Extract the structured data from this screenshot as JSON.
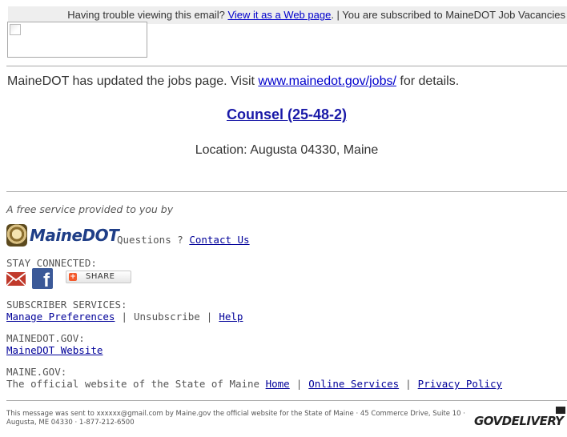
{
  "topbar": {
    "trouble_text": "Having trouble viewing this email?",
    "view_link": "View it as a Web page",
    "subscribed_text": ". | You are subscribed to MaineDOT Job Vacancies"
  },
  "main": {
    "update_prefix": "MaineDOT has updated the jobs page. Visit ",
    "update_link": "www.mainedot.gov/jobs/",
    "update_suffix": " for details.",
    "job_title": "Counsel (25-48-2)",
    "location": "Location: Augusta 04330, Maine"
  },
  "footer": {
    "free_service": "A free service provided to you by",
    "logo_text": "MaineDOT",
    "questions_text": "Questions ?",
    "contact_link": "Contact Us",
    "stay_connected": "STAY CONNECTED:",
    "share_label": "SHARE",
    "subscriber_services": "SUBSCRIBER SERVICES:",
    "manage_preferences": "Manage Preferences",
    "sep1": "|",
    "unsubscribe": "Unsubscribe",
    "sep2": "|",
    "help": "Help",
    "mainedot_gov_label": "MAINEDOT.GOV:",
    "mainedot_website": "MaineDOT Website",
    "maine_gov_label": "MAINE.GOV:",
    "official_text": "The official website of the State of Maine",
    "home": "Home",
    "sep3": "|",
    "online_services": "Online Services",
    "sep4": "|",
    "privacy_policy": "Privacy Policy",
    "fine_print": "This message was sent to xxxxxx@gmail.com by Maine.gov the official website for the State of Maine · 45 Commerce Drive, Suite 10 · Augusta, ME 04330 · 1-877-212-6500",
    "govdelivery": "GOVDELIVERY"
  },
  "colors": {
    "link": "#0000cc",
    "hr": "#a8a8a8",
    "brand_blue": "#1f3e87",
    "facebook": "#3b5998"
  },
  "icons": [
    "email-icon",
    "facebook-icon",
    "share-plus-icon",
    "mainedot-seal-icon",
    "envelope-icon"
  ]
}
